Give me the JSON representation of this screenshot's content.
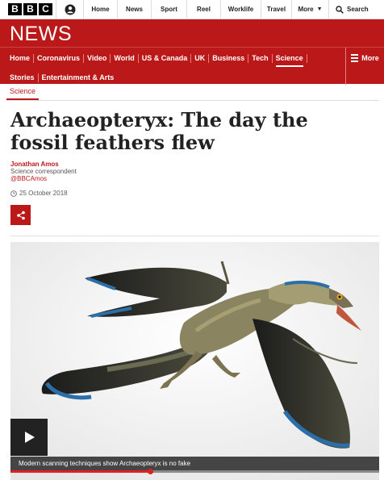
{
  "top_nav": {
    "logo_letters": [
      "B",
      "B",
      "C"
    ],
    "items": [
      "Home",
      "News",
      "Sport",
      "Reel",
      "Worklife",
      "Travel",
      "More"
    ],
    "search_label": "Search"
  },
  "news_band": {
    "wordmark": "NEWS"
  },
  "section_nav": {
    "items": [
      "Home",
      "Coronavirus",
      "Video",
      "World",
      "US & Canada",
      "UK",
      "Business",
      "Tech",
      "Science",
      "Stories",
      "Entertainment & Arts"
    ],
    "active": "Science",
    "more_label": "More"
  },
  "article": {
    "section_label": "Science",
    "headline": "Archaeopteryx: The day the fossil feathers flew",
    "author": "Jonathan Amos",
    "role": "Science correspondent",
    "handle": "@BBCAmos",
    "date": "25 October 2018"
  },
  "video": {
    "caption": "Modern scanning techniques show Archaeopteryx is no fake",
    "progress_fraction": 0.39
  },
  "colors": {
    "brand_red": "#bb1919",
    "progress_red": "#e02020"
  },
  "icons": [
    "account-icon",
    "search-icon",
    "clock-icon",
    "share-icon",
    "play-icon",
    "menu-icon"
  ]
}
